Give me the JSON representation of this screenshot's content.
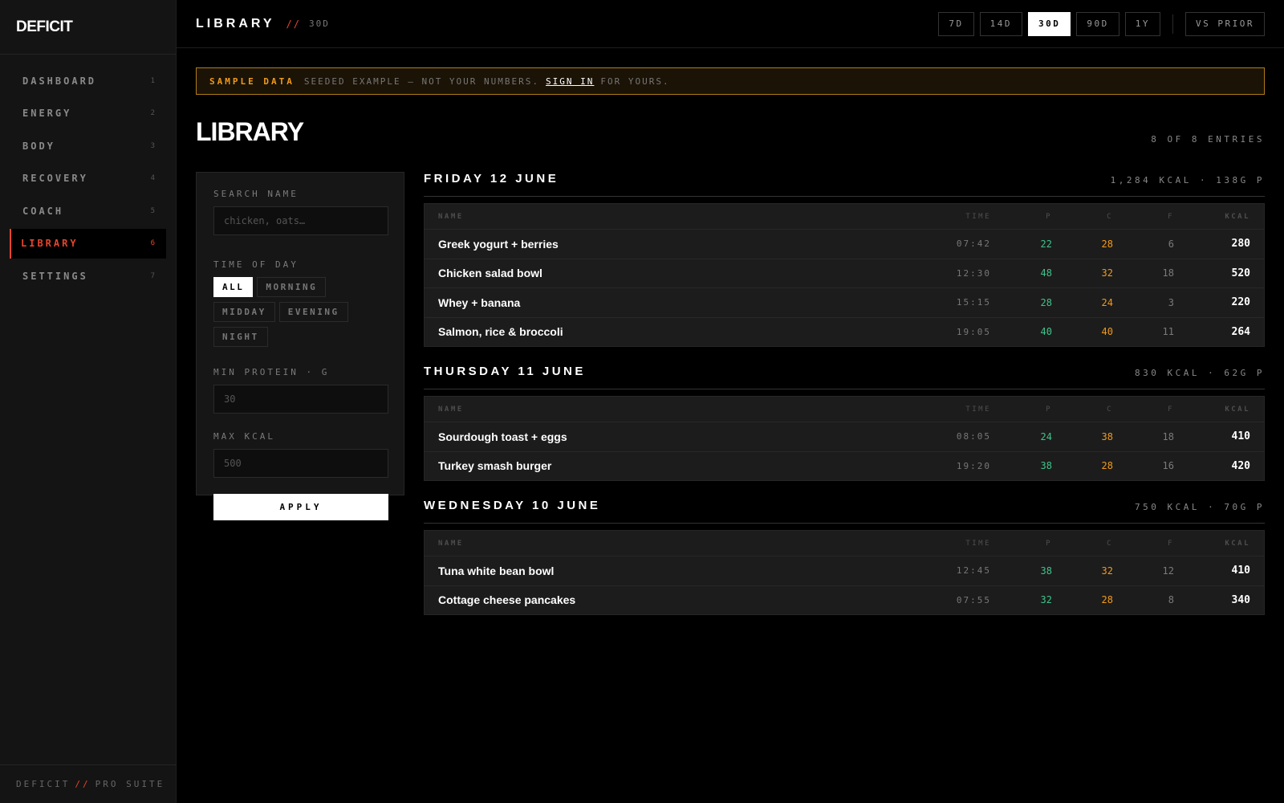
{
  "sidebar": {
    "brand": "DEFICIT",
    "items": [
      {
        "label": "DASHBOARD",
        "num": "1"
      },
      {
        "label": "ENERGY",
        "num": "2"
      },
      {
        "label": "BODY",
        "num": "3"
      },
      {
        "label": "RECOVERY",
        "num": "4"
      },
      {
        "label": "COACH",
        "num": "5"
      },
      {
        "label": "LIBRARY",
        "num": "6"
      },
      {
        "label": "SETTINGS",
        "num": "7"
      }
    ],
    "active_item": "LIBRARY",
    "footer": {
      "left": "DEFICIT",
      "sep": "//",
      "right": "PRO SUITE"
    }
  },
  "header": {
    "title": "LIBRARY",
    "sep": "//",
    "period": "30D",
    "ranges": [
      "7D",
      "14D",
      "30D",
      "90D",
      "1Y"
    ],
    "active_range": "30D",
    "compare": "VS PRIOR"
  },
  "banner": {
    "tag": "SAMPLE DATA",
    "text": "SEEDED EXAMPLE — NOT YOUR NUMBERS.",
    "link": "SIGN IN",
    "suffix": "FOR YOURS."
  },
  "page": {
    "title": "LIBRARY",
    "count": "8 OF 8 ENTRIES"
  },
  "filters": {
    "search_label": "SEARCH NAME",
    "search_placeholder": "chicken, oats…",
    "search_value": "",
    "tod_label": "TIME OF DAY",
    "tod_options": [
      "ALL",
      "MORNING",
      "MIDDAY",
      "EVENING",
      "NIGHT"
    ],
    "tod_active": "ALL",
    "protein_label": "MIN PROTEIN · G",
    "protein_placeholder": "30",
    "kcal_label": "MAX KCAL",
    "kcal_placeholder": "500",
    "apply_label": "APPLY"
  },
  "columns": {
    "name": "NAME",
    "time": "TIME",
    "p": "P",
    "c": "C",
    "f": "F",
    "kcal": "KCAL"
  },
  "accent_colors": {
    "brand_red": "#e8452c",
    "protein": "#3ec48a",
    "carbs": "#f29a1a",
    "banner_border": "#b07d18"
  },
  "days": [
    {
      "name": "FRIDAY 12 JUNE",
      "summary": "1,284 KCAL · 138G P",
      "entries": [
        {
          "name": "Greek yogurt + berries",
          "time": "07:42",
          "p": "22",
          "c": "28",
          "f": "6",
          "kcal": "280"
        },
        {
          "name": "Chicken salad bowl",
          "time": "12:30",
          "p": "48",
          "c": "32",
          "f": "18",
          "kcal": "520"
        },
        {
          "name": "Whey + banana",
          "time": "15:15",
          "p": "28",
          "c": "24",
          "f": "3",
          "kcal": "220"
        },
        {
          "name": "Salmon, rice & broccoli",
          "time": "19:05",
          "p": "40",
          "c": "40",
          "f": "11",
          "kcal": "264"
        }
      ]
    },
    {
      "name": "THURSDAY 11 JUNE",
      "summary": "830 KCAL · 62G P",
      "entries": [
        {
          "name": "Sourdough toast + eggs",
          "time": "08:05",
          "p": "24",
          "c": "38",
          "f": "18",
          "kcal": "410"
        },
        {
          "name": "Turkey smash burger",
          "time": "19:20",
          "p": "38",
          "c": "28",
          "f": "16",
          "kcal": "420"
        }
      ]
    },
    {
      "name": "WEDNESDAY 10 JUNE",
      "summary": "750 KCAL · 70G P",
      "entries": [
        {
          "name": "Tuna white bean bowl",
          "time": "12:45",
          "p": "38",
          "c": "32",
          "f": "12",
          "kcal": "410"
        },
        {
          "name": "Cottage cheese pancakes",
          "time": "07:55",
          "p": "32",
          "c": "28",
          "f": "8",
          "kcal": "340"
        }
      ]
    }
  ]
}
